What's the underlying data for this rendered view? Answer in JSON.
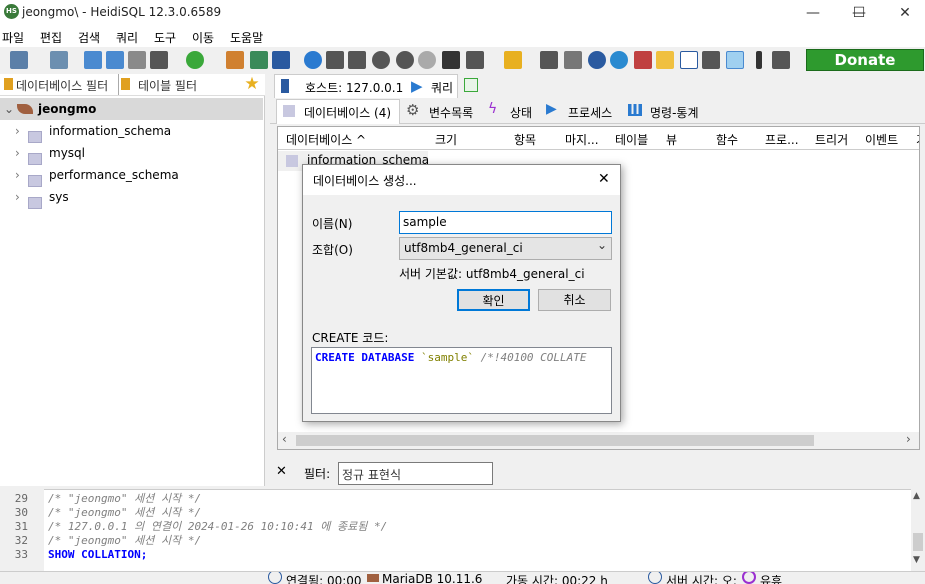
{
  "window": {
    "title": "jeongmo\\ - HeidiSQL 12.3.0.6589",
    "app_icon": "HS",
    "controls": {
      "minimize": "—",
      "maximize": "☐",
      "close": "✕"
    }
  },
  "menu": [
    "파일",
    "편집",
    "검색",
    "쿼리",
    "도구",
    "이동",
    "도움말"
  ],
  "toolbar": {
    "donate_label": "Donate",
    "accent": "#2e9a2e"
  },
  "left_panel": {
    "db_filter_placeholder": "데이터베이스 필터",
    "table_filter_placeholder": "테이블 필터",
    "server": "jeongmo",
    "databases": [
      "information_schema",
      "mysql",
      "performance_schema",
      "sys"
    ]
  },
  "host_tabs": {
    "host": "호스트: 127.0.0.1",
    "query": "쿼리"
  },
  "sub_tabs": {
    "databases": "데이터베이스 (4)",
    "variables": "변수목록",
    "status": "상태",
    "processes": "프로세스",
    "command_stats": "명령-통계"
  },
  "grid": {
    "columns": [
      "데이터베이스 ^",
      "크기",
      "항목",
      "마지...",
      "테이블",
      "뷰",
      "함수",
      "프로...",
      "트리거",
      "이벤트",
      "기"
    ],
    "first_row": "information_schema"
  },
  "dialog": {
    "title": "데이터베이스 생성...",
    "name_label": "이름(N)",
    "name_value": "sample",
    "collation_label": "조합(O)",
    "collation_value": "utf8mb4_general_ci",
    "server_default": "서버 기본값: utf8mb4_general_ci",
    "ok": "확인",
    "cancel": "취소",
    "code_label": "CREATE 코드:",
    "code_kw": "CREATE DATABASE",
    "code_name": "`sample`",
    "code_comment": "/*!40100 COLLATE"
  },
  "filter": {
    "label": "필터:",
    "placeholder": "정규 표현식"
  },
  "log": [
    {
      "num": "29",
      "text": "/* \"jeongmo\" 세션 시작 */"
    },
    {
      "num": "30",
      "text": "/* \"jeongmo\" 세션 시작 */"
    },
    {
      "num": "31",
      "text": "/* 127.0.0.1 의 연결이 2024-01-26 10:10:41 에 종료됨 */"
    },
    {
      "num": "32",
      "text": "/* \"jeongmo\" 세션 시작 */"
    },
    {
      "num": "33",
      "text": "SHOW COLLATION;"
    }
  ],
  "status": {
    "connected": "연결됨: 00:00",
    "server": "MariaDB 10.11.6",
    "uptime": "가동 시간: 00:22 h",
    "server_time": "서버 시간: 오:",
    "idle": "유휴"
  }
}
